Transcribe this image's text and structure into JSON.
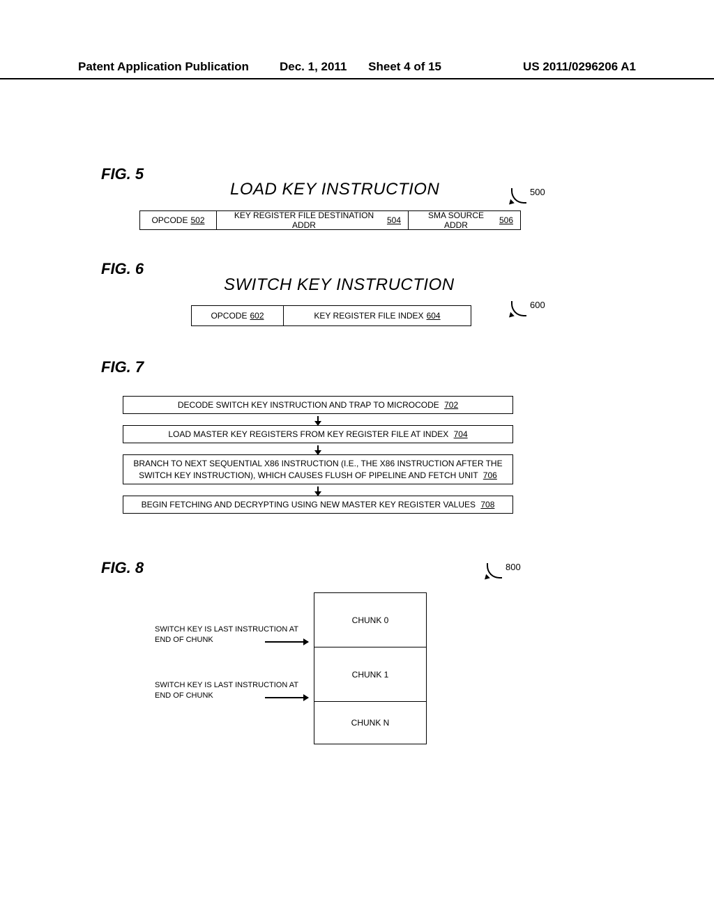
{
  "header": {
    "left": "Patent Application Publication",
    "date": "Dec. 1, 2011",
    "sheet": "Sheet 4 of 15",
    "pubno": "US 2011/0296206 A1"
  },
  "fig5": {
    "label": "FIG. 5",
    "title": "LOAD KEY INSTRUCTION",
    "callout": "500",
    "cells": {
      "c1": "OPCODE",
      "c1ref": "502",
      "c2": "KEY REGISTER FILE DESTINATION ADDR",
      "c2ref": "504",
      "c3": "SMA SOURCE ADDR",
      "c3ref": "506"
    }
  },
  "fig6": {
    "label": "FIG. 6",
    "title": "SWITCH KEY INSTRUCTION",
    "callout": "600",
    "cells": {
      "c1": "OPCODE",
      "c1ref": "602",
      "c2": "KEY REGISTER FILE INDEX",
      "c2ref": "604"
    }
  },
  "fig7": {
    "label": "FIG. 7",
    "steps": {
      "s1": "DECODE SWITCH KEY INSTRUCTION AND TRAP TO MICROCODE",
      "s1ref": "702",
      "s2": "LOAD MASTER KEY REGISTERS FROM KEY REGISTER FILE AT INDEX",
      "s2ref": "704",
      "s3": "BRANCH TO NEXT SEQUENTIAL X86 INSTRUCTION (I.E., THE X86 INSTRUCTION AFTER THE SWITCH KEY INSTRUCTION), WHICH CAUSES FLUSH OF PIPELINE AND FETCH UNIT",
      "s3ref": "706",
      "s4": "BEGIN FETCHING AND DECRYPTING USING NEW MASTER KEY REGISTER VALUES",
      "s4ref": "708"
    }
  },
  "fig8": {
    "label": "FIG. 8",
    "callout": "800",
    "chunks": {
      "c0": "CHUNK 0",
      "c1": "CHUNK 1",
      "cn": "CHUNK N"
    },
    "notes": {
      "n1": "SWITCH KEY IS LAST INSTRUCTION AT END OF CHUNK",
      "n2": "SWITCH KEY IS LAST INSTRUCTION AT END OF CHUNK"
    }
  }
}
